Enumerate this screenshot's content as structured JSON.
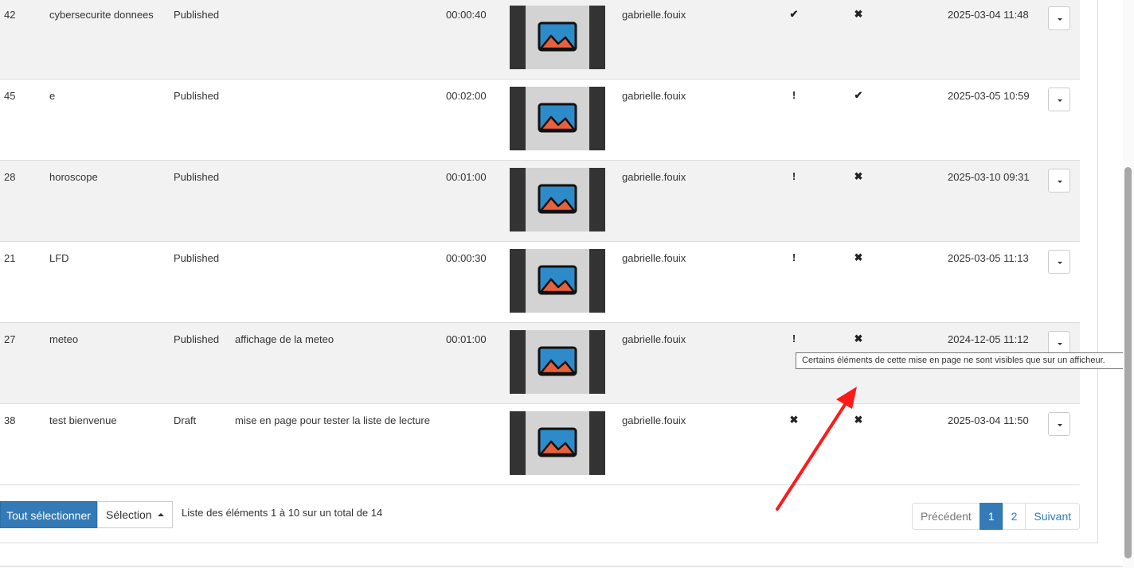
{
  "rows": [
    {
      "id": "42",
      "name": "cybersecurite donnees",
      "status": "Published",
      "description": "",
      "duration": "00:00:40",
      "owner": "gabrielle.fouix",
      "flag_a": "✔",
      "flag_b": "✖",
      "date": "2025-03-04 11:48"
    },
    {
      "id": "45",
      "name": "e",
      "status": "Published",
      "description": "",
      "duration": "00:02:00",
      "owner": "gabrielle.fouix",
      "flag_a": "!",
      "flag_b": "✔",
      "date": "2025-03-05 10:59"
    },
    {
      "id": "28",
      "name": "horoscope",
      "status": "Published",
      "description": "",
      "duration": "00:01:00",
      "owner": "gabrielle.fouix",
      "flag_a": "!",
      "flag_b": "✖",
      "date": "2025-03-10 09:31"
    },
    {
      "id": "21",
      "name": "LFD",
      "status": "Published",
      "description": "",
      "duration": "00:00:30",
      "owner": "gabrielle.fouix",
      "flag_a": "!",
      "flag_b": "✖",
      "date": "2025-03-05 11:13"
    },
    {
      "id": "27",
      "name": "meteo",
      "status": "Published",
      "description": "affichage de la meteo",
      "duration": "00:01:00",
      "owner": "gabrielle.fouix",
      "flag_a": "!",
      "flag_b": "✖",
      "date": "2024-12-05 11:12"
    },
    {
      "id": "38",
      "name": "test bienvenue",
      "status": "Draft",
      "description": "mise en page pour tester la liste de lecture",
      "duration": "",
      "owner": "gabrielle.fouix",
      "flag_a": "✖",
      "flag_b": "✖",
      "date": "2025-03-04 11:50"
    }
  ],
  "tooltip": "Certains éléments de cette mise en page ne sont visibles que sur un afficheur.",
  "footer": {
    "select_all": "Tout sélectionner",
    "selection": "Sélection",
    "list_info": "Liste des éléments 1 à 10 sur un total de 14"
  },
  "pagination": {
    "previous": "Précédent",
    "pages": [
      "1",
      "2"
    ],
    "next": "Suivant"
  },
  "colors": {
    "primary": "#337ab7",
    "annotation_arrow": "#ff1a1a",
    "thumb_sky": "#2e8bc9",
    "thumb_mountain": "#e8603c"
  }
}
